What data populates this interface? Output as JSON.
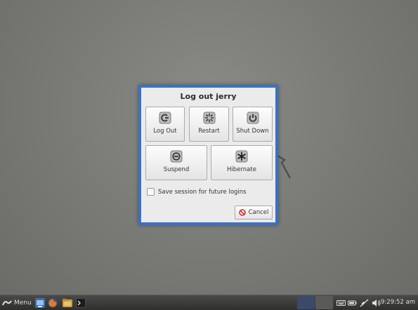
{
  "dialog": {
    "title": "Log out jerry",
    "buttons": {
      "logout": "Log Out",
      "restart": "Restart",
      "shutdown": "Shut Down",
      "suspend": "Suspend",
      "hibernate": "Hibernate"
    },
    "save_session_label": "Save session for future logins",
    "save_session_checked": false,
    "cancel_label": "Cancel"
  },
  "taskbar": {
    "menu_label": "Menu",
    "clock": "9:29:52 am",
    "launchers": [
      "file-manager-icon",
      "firefox-icon",
      "home-folder-icon",
      "terminal-icon"
    ],
    "workspaces": [
      "workspace-1",
      "workspace-2"
    ],
    "tray": [
      "keyboard-icon",
      "battery-icon",
      "network-icon",
      "volume-icon"
    ]
  },
  "colors": {
    "dialog_border": "#3a71c4",
    "dialog_bg": "#ebebeb",
    "desktop_bg": "#7b7c78",
    "taskbar_bg": "#3a3a39",
    "workspace_active": "#3b4a6b",
    "workspace_inactive": "#5a5a58",
    "cancel_icon": "#d22e2e"
  }
}
